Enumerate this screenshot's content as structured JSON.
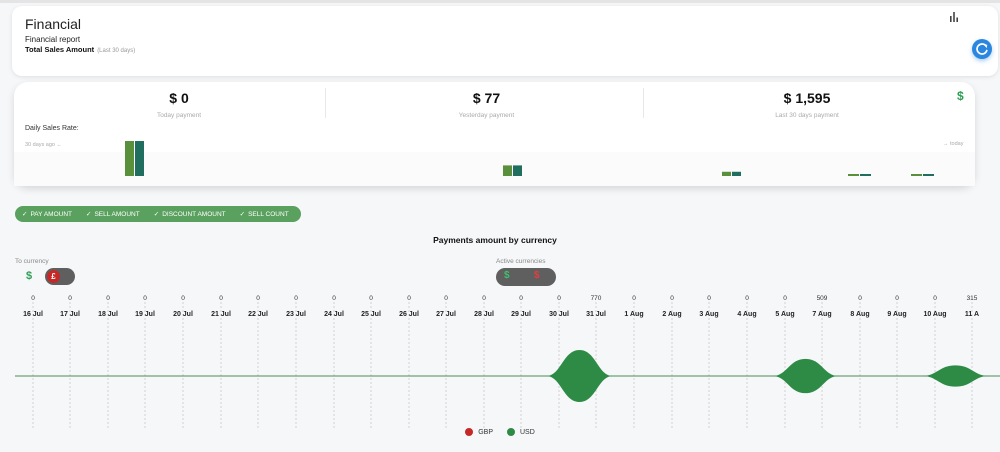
{
  "header": {
    "title": "Financial",
    "subtitle": "Financial report",
    "total_sales_label": "Total Sales Amount",
    "total_sales_note": "(Last 30 days)",
    "chart_icon": "bar-chart-icon",
    "refresh_icon": "refresh-icon"
  },
  "stats": [
    {
      "value": "$ 0",
      "label": "Today payment"
    },
    {
      "value": "$ 77",
      "label": "Yesterday payment"
    },
    {
      "value": "$ 1,595",
      "label": "Last 30 days payment"
    }
  ],
  "stats_icon": "$",
  "daily": {
    "label": "Daily Sales Rate:",
    "start_label": "30 days ago",
    "end_label": "today"
  },
  "filters": [
    "PAY AMOUNT",
    "SELL AMOUNT",
    "DISCOUNT AMOUNT",
    "SELL COUNT"
  ],
  "currency": {
    "to_label": "To currency",
    "to_symbol": "$",
    "to_knob": "£",
    "active_label": "Active currencies",
    "active_a": "$",
    "active_b": "$"
  },
  "colors": {
    "accent_green": "#5aa15f",
    "usd": "#2e8b46",
    "gbp": "#c62828",
    "bar_a": "#5a8f3c",
    "bar_b": "#1f6e5e",
    "refresh": "#2b86e0"
  },
  "chart_data": [
    {
      "type": "bar",
      "title": "Daily Sales Rate:",
      "series": [
        {
          "values": [
            3.3,
            1.0,
            0.4,
            0.1,
            0.1
          ]
        },
        {
          "values": [
            3.3,
            1.0,
            0.4,
            0.1,
            0.1
          ]
        }
      ]
    },
    {
      "type": "area",
      "title": "Payments amount by currency",
      "categories": [
        "16 Jul",
        "17 Jul",
        "18 Jul",
        "19 Jul",
        "20 Jul",
        "21 Jul",
        "22 Jul",
        "23 Jul",
        "24 Jul",
        "25 Jul",
        "26 Jul",
        "27 Jul",
        "28 Jul",
        "29 Jul",
        "30 Jul",
        "31 Jul",
        "1 Aug",
        "2 Aug",
        "3 Aug",
        "4 Aug",
        "5 Aug",
        "7 Aug",
        "8 Aug",
        "9 Aug",
        "10 Aug",
        "11 A"
      ],
      "series": [
        {
          "name": "USD",
          "values": [
            0,
            0,
            0,
            0,
            0,
            0,
            0,
            0,
            0,
            0,
            0,
            0,
            0,
            0,
            0,
            770,
            0,
            0,
            0,
            0,
            0,
            509,
            0,
            0,
            0,
            315
          ]
        },
        {
          "name": "GBP",
          "values": [
            0,
            0,
            0,
            0,
            0,
            0,
            0,
            0,
            0,
            0,
            0,
            0,
            0,
            0,
            0,
            0,
            0,
            0,
            0,
            0,
            0,
            0,
            0,
            0,
            0,
            0
          ]
        }
      ],
      "legend": [
        "GBP",
        "USD"
      ],
      "legend_position": "bottom"
    }
  ]
}
